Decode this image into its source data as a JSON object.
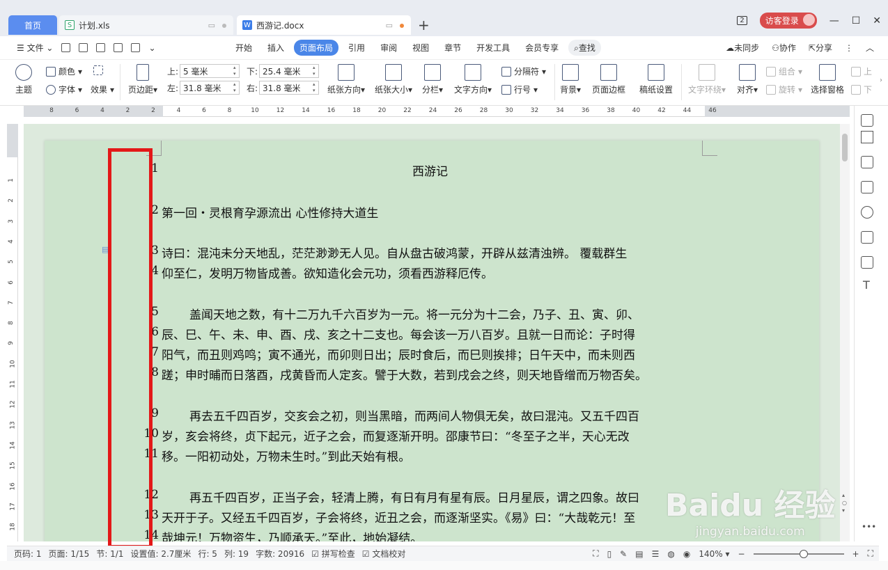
{
  "tabs": {
    "home": "首页",
    "xls": "计划.xls",
    "doc": "西游记.docx",
    "badge": "2",
    "login": "访客登录"
  },
  "menubar": {
    "file": "文件",
    "items": [
      "开始",
      "插入",
      "页面布局",
      "引用",
      "审阅",
      "视图",
      "章节",
      "开发工具",
      "会员专享"
    ],
    "active": "页面布局",
    "search": "查找",
    "sync": "未同步",
    "collab": "协作",
    "share": "分享"
  },
  "ribbon": {
    "theme": "主题",
    "color": "颜色",
    "font": "字体",
    "effect": "效果",
    "margin": "页边距",
    "top_label": "上:",
    "top_value": "5 毫米",
    "bottom_label": "下:",
    "bottom_value": "25.4 毫米",
    "left_label": "左:",
    "left_value": "31.8 毫米",
    "right_label": "右:",
    "right_value": "31.8 毫米",
    "orientation": "纸张方向",
    "size": "纸张大小",
    "columns": "分栏",
    "text_direction": "文字方向",
    "separator": "分隔符",
    "line_number": "行号",
    "background": "背景",
    "page_border": "页面边框",
    "paper_setup": "稿纸设置",
    "text_wrap": "文字环绕",
    "align": "对齐",
    "group": "组合",
    "rotate": "旋转",
    "selection_pane": "选择窗格",
    "up": "上",
    "down": "下"
  },
  "ruler": {
    "h_ticks": [
      "8",
      "6",
      "4",
      "2",
      "2",
      "4",
      "6",
      "8",
      "10",
      "12",
      "14",
      "16",
      "18",
      "20",
      "22",
      "24",
      "26",
      "28",
      "30",
      "32",
      "34",
      "36",
      "38",
      "40",
      "42",
      "44",
      "46"
    ],
    "v_ticks": [
      "1",
      "2",
      "3",
      "4",
      "5",
      "6",
      "7",
      "8",
      "9",
      "10",
      "11",
      "12",
      "13",
      "14",
      "15",
      "16",
      "17",
      "18"
    ]
  },
  "document": {
    "line_numbers": [
      "1",
      "2",
      "3",
      "4",
      "5",
      "6",
      "7",
      "8",
      "9",
      "10",
      "11",
      "12",
      "13",
      "14"
    ],
    "lines": [
      "西游记",
      "第一回・灵根育孕源流出 心性修持大道生",
      "诗曰：混沌未分天地乱，茫茫渺渺无人见。自从盘古破鸿蒙，开辟从兹清浊辨。 覆载群生",
      "仰至仁，发明万物皆成善。欲知造化会元功，须看西游释厄传。",
      "盖闻天地之数，有十二万九千六百岁为一元。将一元分为十二会，乃子、丑、寅、卯、",
      "辰、巳、午、未、申、酉、戌、亥之十二支也。每会该一万八百岁。且就一日而论：子时得",
      "阳气，而丑则鸡鸣；寅不通光，而卯则日出；辰时食后，而巳则挨排；日午天中，而未则西",
      "蹉；申时晡而日落酉，戌黄昏而人定亥。譬于大数，若到戌会之终，则天地昏缯而万物否矣。",
      "再去五千四百岁，交亥会之初，则当黑暗，而两间人物俱无矣，故曰混沌。又五千四百",
      "岁，亥会将终，贞下起元，近子之会，而复逐渐开明。邵康节曰：“冬至子之半，天心无改",
      "移。一阳初动处，万物未生时。”到此天始有根。",
      "再五千四百岁，正当子会，轻清上腾，有日有月有星有辰。日月星辰，谓之四象。故曰",
      "天开于子。又经五千四百岁，子会将终，近丑之会，而逐渐坚实。《易》曰：“大哉乾元！至",
      "哉坤元！万物资生，乃顺承天。”至此，地始凝结。"
    ]
  },
  "status": {
    "page_code": "页码: 1",
    "page": "页面: 1/15",
    "section": "节: 1/1",
    "setting": "设置值: 2.7厘米",
    "row": "行: 5",
    "col": "列: 19",
    "words": "字数: 20916",
    "spell": "拼写检查",
    "proof": "文档校对",
    "zoom": "140%"
  },
  "watermark": {
    "brand": "Baidu 经验",
    "url": "jingyan.baidu.com"
  },
  "colors": {
    "accent": "#4a86e8",
    "page_bg": "#cde4cd",
    "highlight_box": "#e31818",
    "login_bg": "#d94c4c"
  }
}
